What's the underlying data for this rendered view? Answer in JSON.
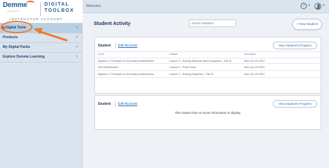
{
  "brand": {
    "name": "Demme",
    "sub": "LEARNING",
    "product_line1": "DIGITAL",
    "product_line2": "TOOLBOX",
    "account": "INSTRUCTOR ACCOUNT"
  },
  "topbar": {
    "welcome": "Welcome,",
    "help_glyph": "?",
    "chevron": "▾"
  },
  "sidebar": {
    "items": [
      {
        "label": "Digital Tools",
        "active": true
      },
      {
        "label": "Products",
        "active": false
      },
      {
        "label": "My Digital Packs",
        "active": false
      },
      {
        "label": "Explore Demme Learning",
        "active": false
      }
    ],
    "chevron": "›"
  },
  "main": {
    "title": "Student Activity",
    "search_placeholder": "Search Students",
    "new_student_label": "+ New Student"
  },
  "card1": {
    "student_label": "Student",
    "edit_label": "Edit Account",
    "view_progress_label": "View Student's Progress",
    "columns": [
      "Level",
      "Lesson",
      "Accessed"
    ],
    "rows": [
      [
        "Algebra 1: Principles of Secondary Mathematics",
        "Lesson 3 - Solving Absolute Value Equations - Part B",
        "Mon Jun 20 2022"
      ],
      [
        "A/M Multiplication",
        "Lesson 6 - Fives Facts",
        "Mon Jun 20 2022"
      ],
      [
        "Algebra 1: Principles of Secondary Mathematics",
        "Lesson 2 - Solving Equations - Part B",
        "Mon Jun 20 2022"
      ]
    ]
  },
  "card2": {
    "student_label": "Student",
    "edit_label": "Edit Account",
    "view_progress_label": "View Student's Progress",
    "empty_message": "This student has no recent information to display."
  },
  "colors": {
    "accent": "#f07a2a",
    "link": "#2d6db3",
    "sidebar": "#d9e4ef"
  }
}
